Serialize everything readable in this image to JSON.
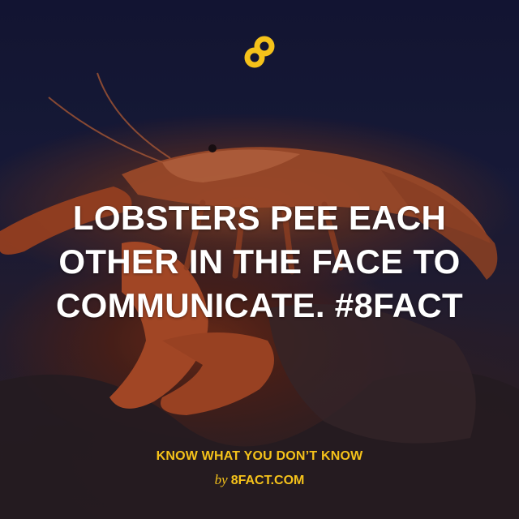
{
  "logo": {
    "icon": "8fact-logo-icon",
    "color": "#f5c21a"
  },
  "fact": {
    "lines": [
      "LOBSTERS PEE EACH",
      "OTHER IN THE FACE TO",
      "COMMUNICATE. #8FACT"
    ]
  },
  "footer": {
    "tagline": "KNOW WHAT YOU DON’T KNOW",
    "by": "by",
    "site": "8FACT.COM"
  },
  "colors": {
    "accent": "#f5c21a",
    "text": "#ffffff",
    "background": "#181c3a"
  }
}
